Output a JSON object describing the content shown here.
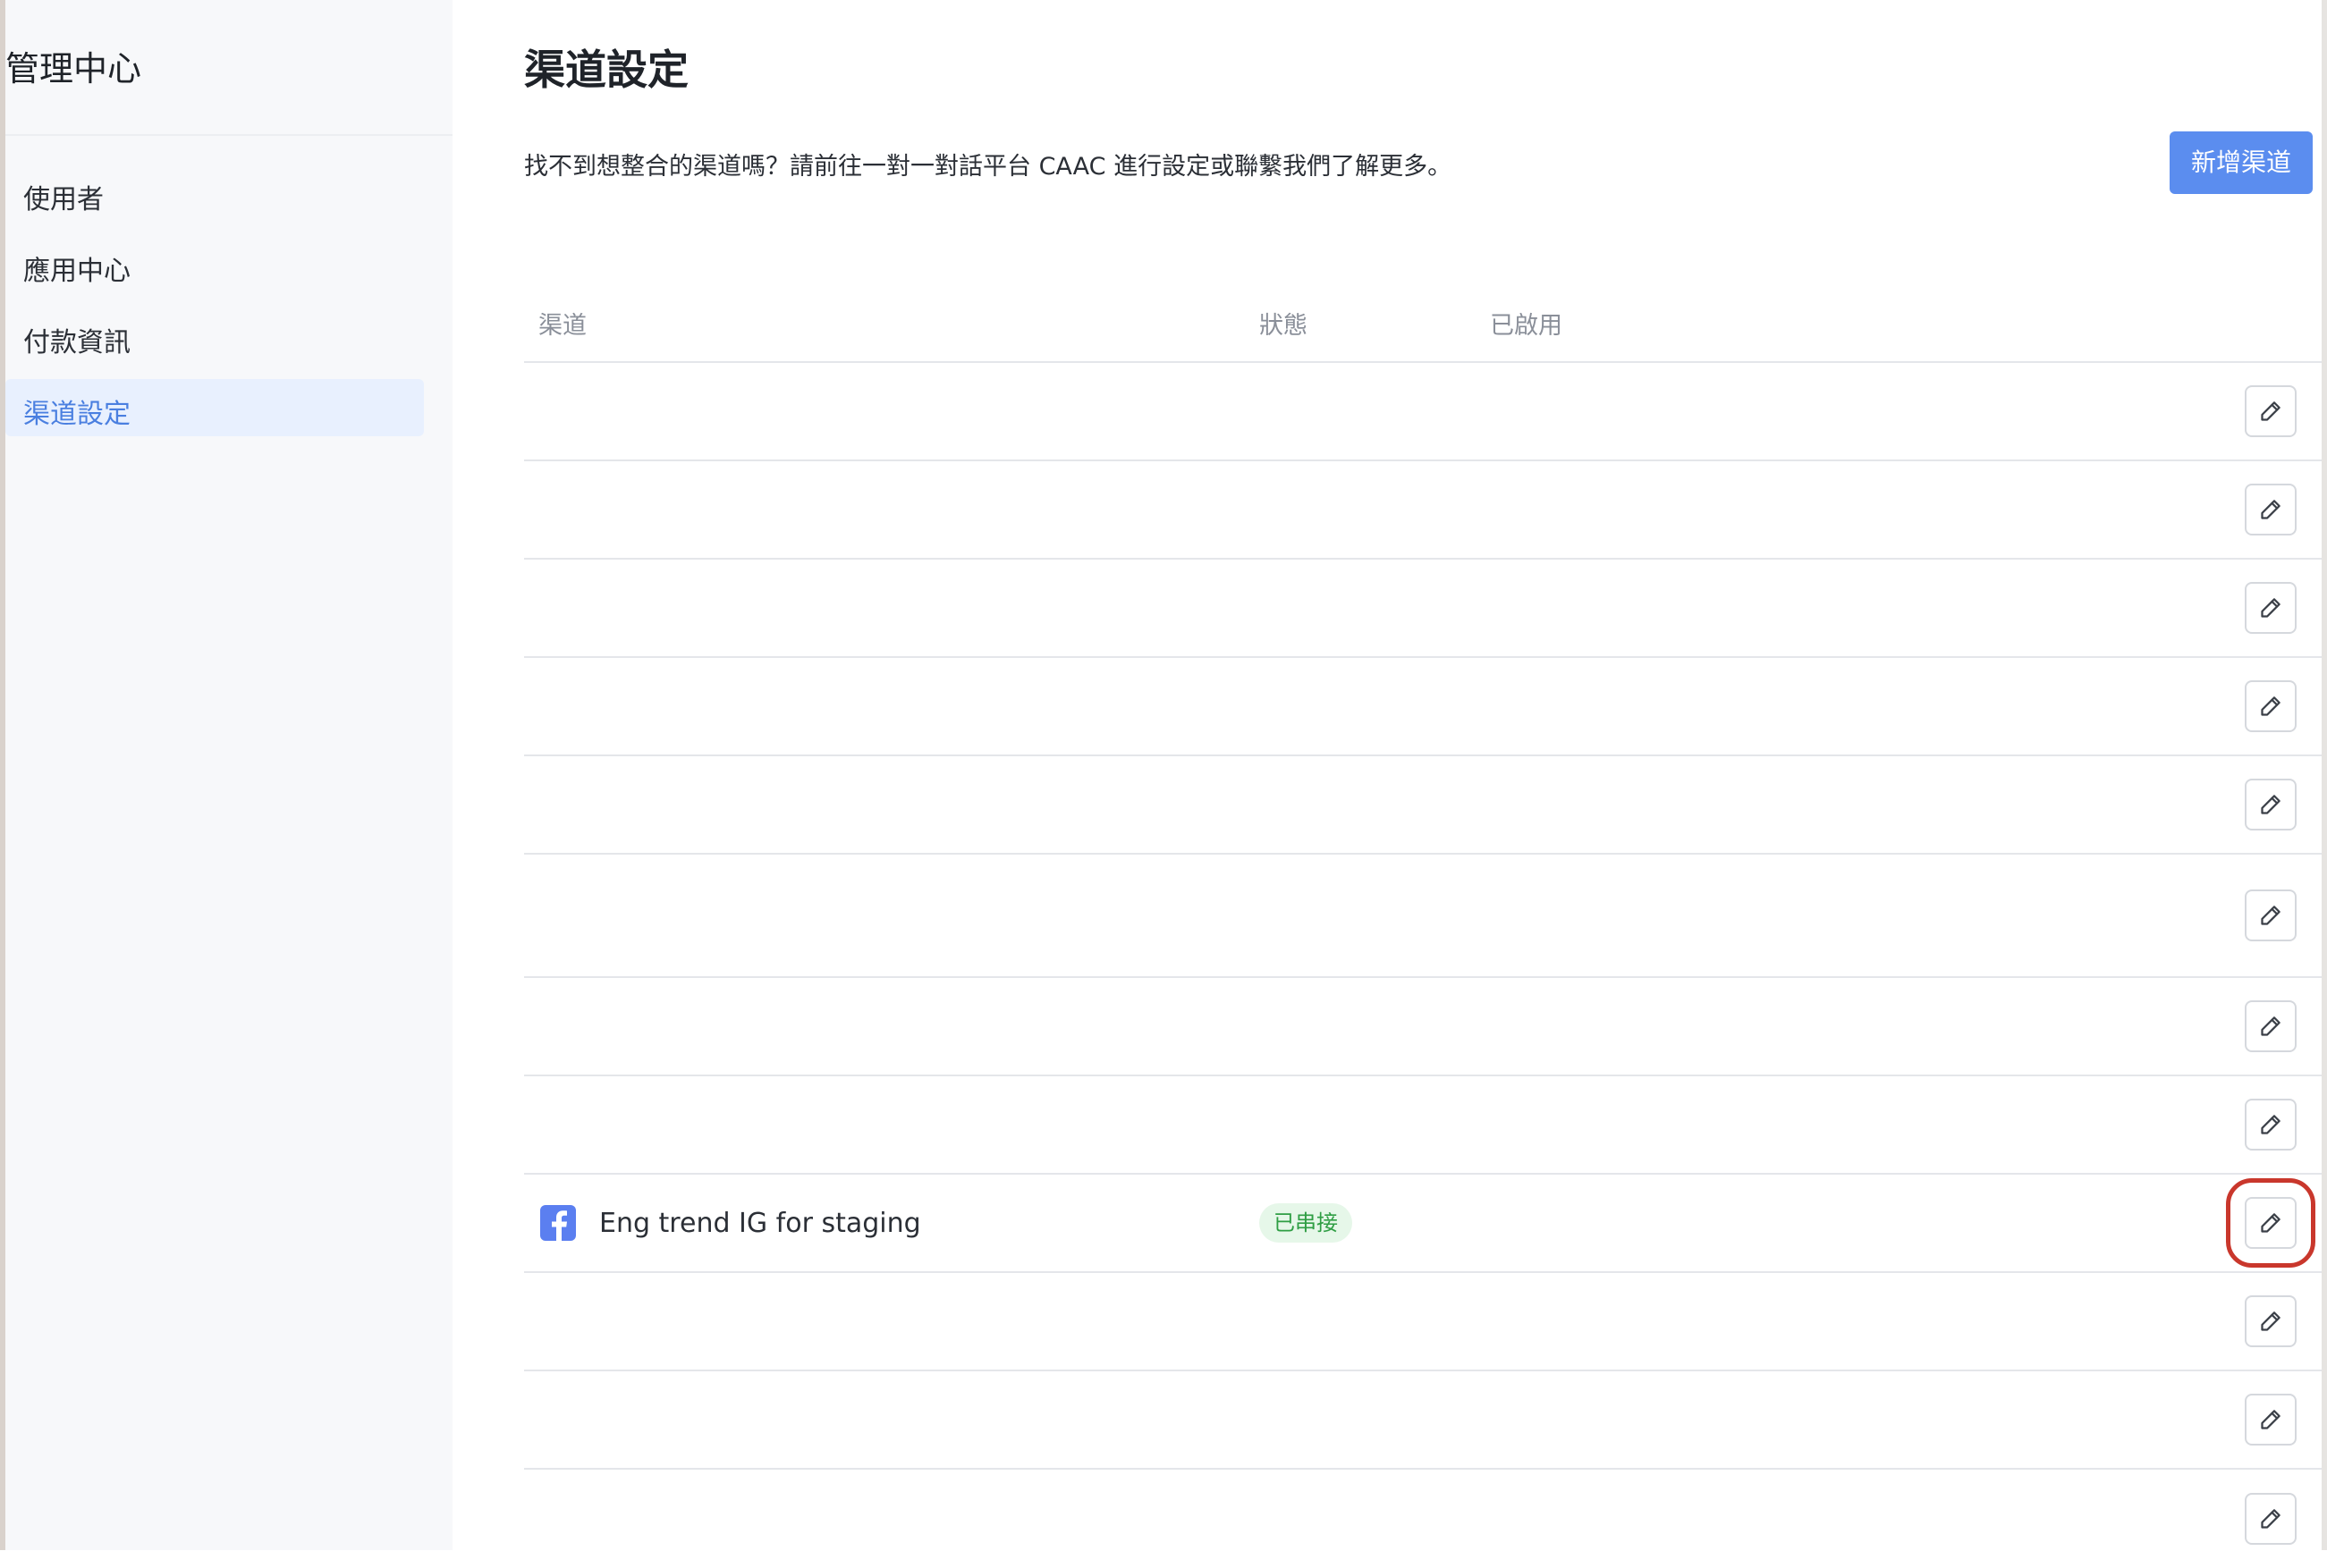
{
  "sidebar": {
    "title": "管理中心",
    "items": [
      {
        "label": "使用者",
        "active": false
      },
      {
        "label": "應用中心",
        "active": false
      },
      {
        "label": "付款資訊",
        "active": false
      },
      {
        "label": "渠道設定",
        "active": true
      }
    ]
  },
  "main": {
    "title": "渠道設定",
    "description": "找不到想整合的渠道嗎？請前往一對一對話平台 CAAC 進行設定或聯繫我們了解更多。",
    "add_button_label": "新增渠道",
    "table": {
      "columns": {
        "channel": "渠道",
        "status": "狀態",
        "enabled": "已啟用"
      },
      "rows": [
        {
          "channel": "",
          "status": "",
          "enabled": ""
        },
        {
          "channel": "",
          "status": "",
          "enabled": ""
        },
        {
          "channel": "",
          "status": "",
          "enabled": ""
        },
        {
          "channel": "",
          "status": "",
          "enabled": ""
        },
        {
          "channel": "",
          "status": "",
          "enabled": ""
        },
        {
          "channel": "",
          "status": "",
          "enabled": ""
        },
        {
          "channel": "",
          "status": "",
          "enabled": ""
        },
        {
          "channel": "",
          "status": "",
          "enabled": ""
        },
        {
          "channel": "Eng trend IG for staging",
          "icon": "facebook-icon",
          "status": "已串接",
          "enabled": "",
          "edit_highlighted": true
        },
        {
          "channel": "",
          "status": "",
          "enabled": ""
        },
        {
          "channel": "",
          "status": "",
          "enabled": ""
        },
        {
          "channel": "",
          "status": "",
          "enabled": ""
        }
      ]
    }
  },
  "colors": {
    "accent": "#5b8def",
    "active_nav_bg": "#e8f0fe",
    "active_nav_text": "#4a7fe0",
    "status_badge_bg": "#e6f7e9",
    "status_badge_text": "#2f9e44",
    "highlight_box": "#c9372c",
    "facebook_blue": "#5b7ff0"
  },
  "icons": {
    "edit": "pencil-icon",
    "channel": "facebook-icon"
  }
}
